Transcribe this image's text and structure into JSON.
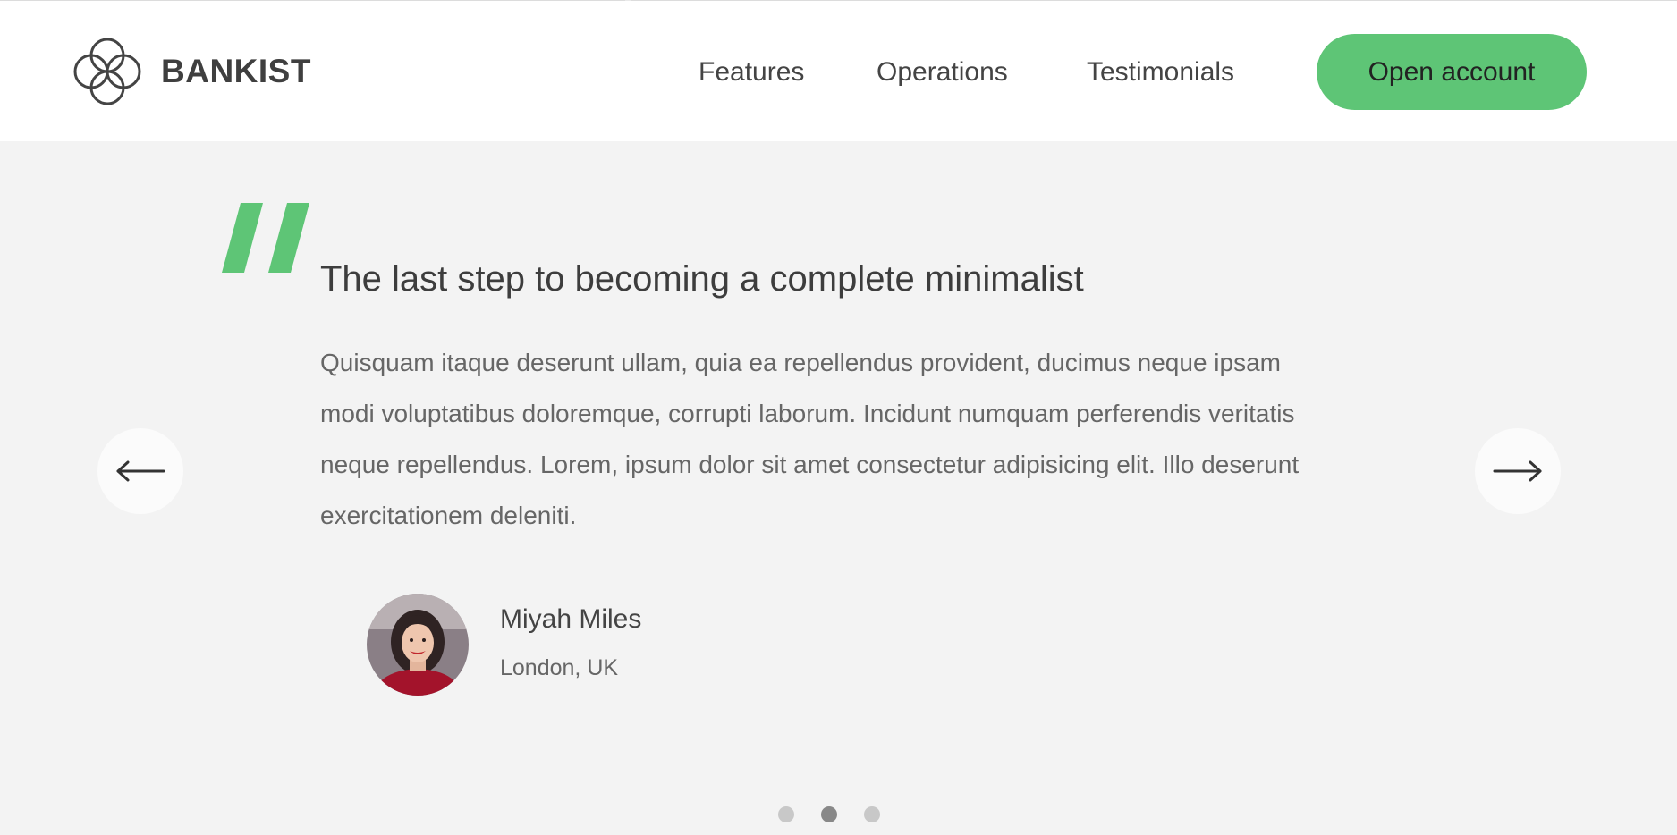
{
  "brand": {
    "name": "BANKIST",
    "accent": "#5ec576"
  },
  "nav": {
    "links": [
      {
        "label": "Features"
      },
      {
        "label": "Operations"
      },
      {
        "label": "Testimonials"
      }
    ],
    "cta_label": "Open account"
  },
  "testimonial": {
    "title": "The last step to becoming a complete minimalist",
    "body": "Quisquam itaque deserunt ullam, quia ea repellendus provident, ducimus neque ipsam modi voluptatibus doloremque, corrupti laborum. Incidunt numquam perferendis veritatis neque repellendus. Lorem, ipsum dolor sit amet consectetur adipisicing elit. Illo deserunt exercitationem deleniti.",
    "author": {
      "name": "Miyah Miles",
      "location": "London, UK"
    }
  },
  "slider": {
    "prev_icon": "arrow-left-icon",
    "next_icon": "arrow-right-icon",
    "dots_count": 3,
    "active_dot": 2
  }
}
